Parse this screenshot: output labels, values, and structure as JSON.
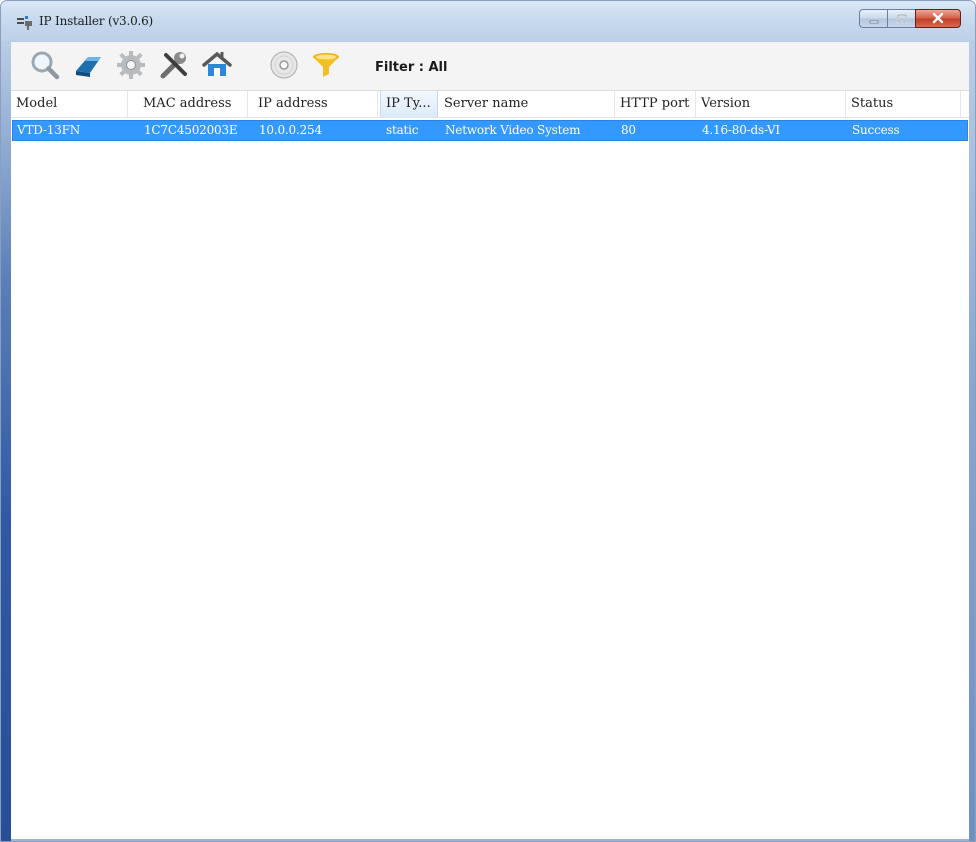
{
  "window": {
    "title": "IP Installer (v3.0.6)",
    "icons": {
      "app": "network-app-icon",
      "minimize": "minimize-icon",
      "maximize": "maximize-icon",
      "close": "close-icon"
    }
  },
  "toolbar": {
    "buttons": [
      {
        "name": "search-icon",
        "tooltip": ""
      },
      {
        "name": "eraser-icon",
        "tooltip": ""
      },
      {
        "name": "gear-icon",
        "tooltip": ""
      },
      {
        "name": "tools-icon",
        "tooltip": ""
      },
      {
        "name": "home-network-icon",
        "tooltip": ""
      },
      {
        "name": "cd-disc-icon",
        "tooltip": ""
      },
      {
        "name": "funnel-filter-icon",
        "tooltip": ""
      }
    ],
    "filter_label": "Filter : All"
  },
  "table": {
    "columns": [
      "Model",
      "MAC address",
      "IP address",
      "IP Ty...",
      "Server name",
      "HTTP port",
      "Version",
      "Status"
    ],
    "rows": [
      [
        "VTD-13FN",
        "1C7C4502003E",
        "10.0.0.254",
        "static",
        "Network Video System",
        "80",
        "4.16-80-ds-VI",
        "Success"
      ]
    ],
    "selected_row_color": "#3399ff"
  }
}
